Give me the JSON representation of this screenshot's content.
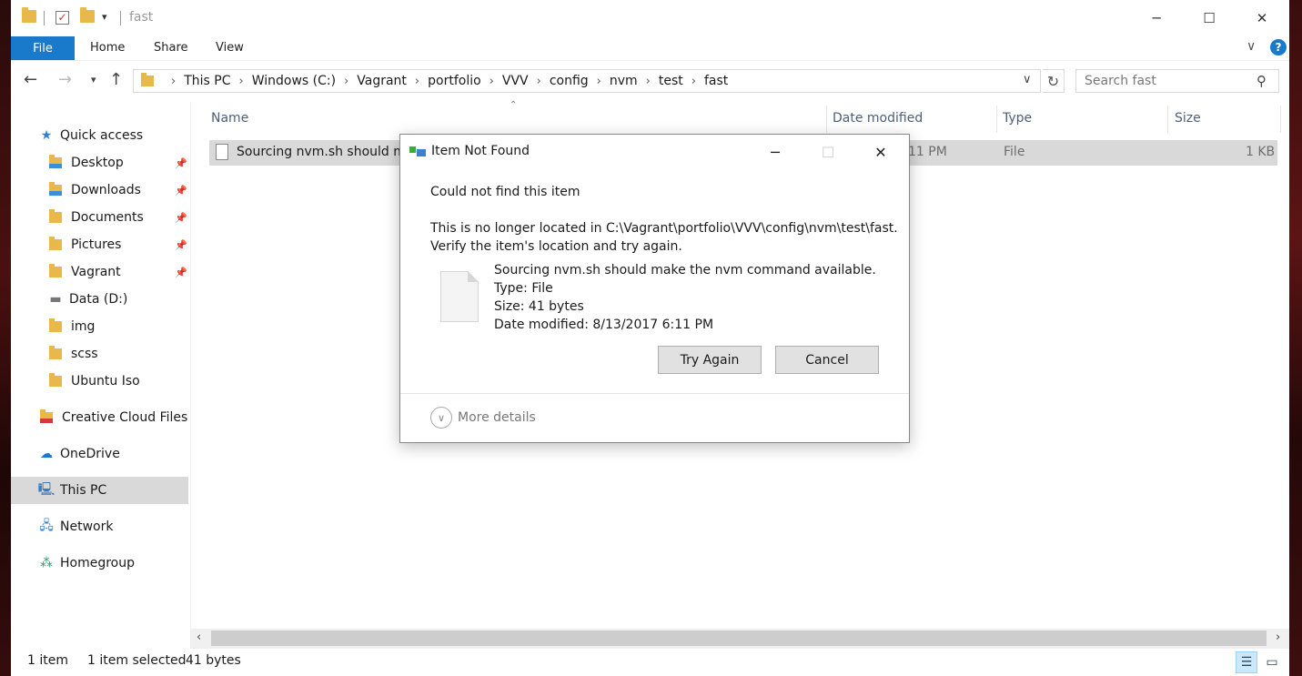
{
  "window": {
    "title": "fast",
    "controls": {
      "minimize": "─",
      "maximize": "☐",
      "close": "✕"
    }
  },
  "ribbon": {
    "tabs": [
      "File",
      "Home",
      "Share",
      "View"
    ],
    "help": "?"
  },
  "address": {
    "crumbs": [
      "This PC",
      "Windows (C:)",
      "Vagrant",
      "portfolio",
      "VVV",
      "config",
      "nvm",
      "test",
      "fast"
    ],
    "search_placeholder": "Search fast"
  },
  "nav": {
    "quick_access": "Quick access",
    "items": [
      {
        "label": "Desktop",
        "pinned": true
      },
      {
        "label": "Downloads",
        "pinned": true
      },
      {
        "label": "Documents",
        "pinned": true
      },
      {
        "label": "Pictures",
        "pinned": true
      },
      {
        "label": "Vagrant",
        "pinned": true
      },
      {
        "label": "Data (D:)",
        "pinned": false
      },
      {
        "label": "img",
        "pinned": false
      },
      {
        "label": "scss",
        "pinned": false
      },
      {
        "label": "Ubuntu Iso",
        "pinned": false
      }
    ],
    "creative_cloud": "Creative Cloud Files",
    "onedrive": "OneDrive",
    "this_pc": "This PC",
    "network": "Network",
    "homegroup": "Homegroup"
  },
  "file_list": {
    "columns": [
      "Name",
      "Date modified",
      "Type",
      "Size"
    ],
    "rows": [
      {
        "name": "Sourcing nvm.sh should ma",
        "date": "11 PM",
        "type": "File",
        "size": "1 KB"
      }
    ]
  },
  "status": {
    "item_count": "1 item",
    "selected": "1 item selected",
    "selected_size": "41 bytes"
  },
  "dialog": {
    "title": "Item Not Found",
    "heading": "Could not find this item",
    "message_line1": "This is no longer located in C:\\Vagrant\\portfolio\\VVV\\config\\nvm\\test\\fast.",
    "message_line2": "Verify the item's location and try again.",
    "file_name": "Sourcing nvm.sh should make the nvm command available.",
    "file_type": "Type: File",
    "file_size": "Size: 41 bytes",
    "file_date": "Date modified: 8/13/2017 6:11 PM",
    "try_again": "Try Again",
    "cancel": "Cancel",
    "more_details": "More details"
  },
  "colors": {
    "accent": "#1979ca",
    "selection": "#d9d9d9",
    "folder": "#e8b94a"
  }
}
